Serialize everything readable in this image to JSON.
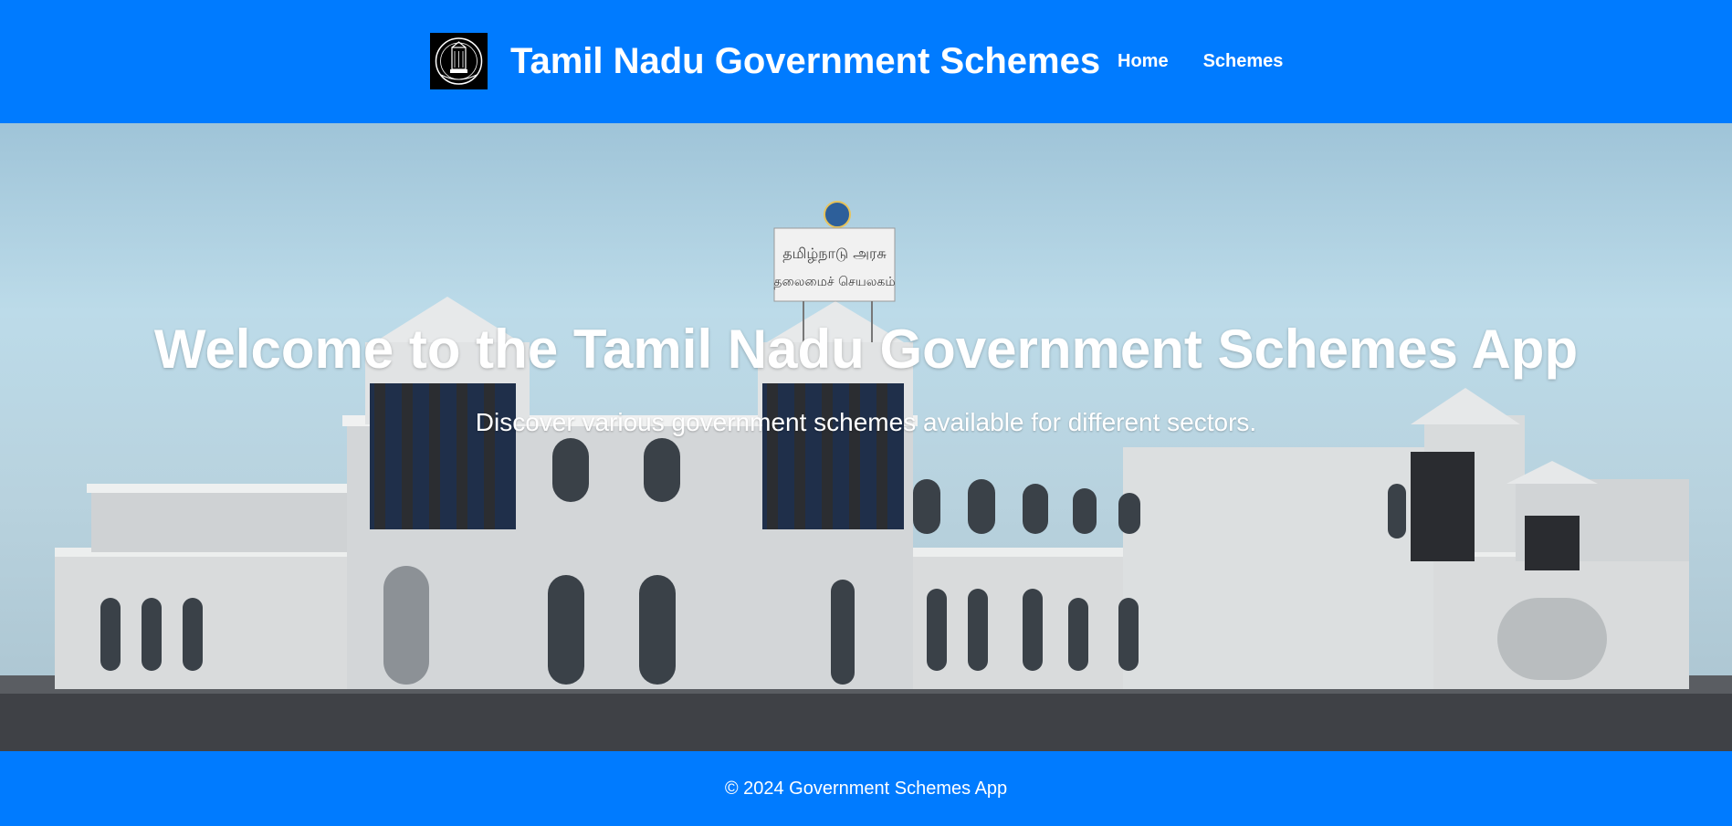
{
  "header": {
    "title": "Tamil Nadu Government Schemes",
    "logo_icon": "tamil-nadu-emblem-icon",
    "nav": [
      {
        "label": "Home"
      },
      {
        "label": "Schemes"
      }
    ],
    "background_color": "#007bff"
  },
  "hero": {
    "title": "Welcome to the Tamil Nadu Government Schemes App",
    "subtitle": "Discover various government schemes available for different sectors.",
    "background": "photo of Tamil Nadu Secretariat building",
    "building_sign": [
      "தமிழ்நாடு அரசு",
      "தலைமைச் செயலகம்"
    ]
  },
  "footer": {
    "text": "© 2024 Government Schemes App"
  }
}
